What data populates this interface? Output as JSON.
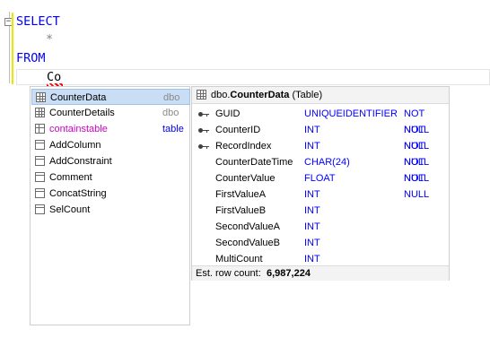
{
  "editor": {
    "line1": "SELECT",
    "line2": "*",
    "line3": "FROM",
    "line4": "Co"
  },
  "completion_list": {
    "items": [
      {
        "label": "CounterData",
        "schema": "dbo",
        "icon": "table-icon",
        "selected": true
      },
      {
        "label": "CounterDetails",
        "schema": "dbo",
        "icon": "table-icon"
      },
      {
        "label": "containstable",
        "schema": "table",
        "icon": "table-valued-function-icon",
        "label_color": "#d000c8",
        "schema_color": "#0000ff"
      },
      {
        "label": "AddColumn",
        "schema": "",
        "icon": "function-icon"
      },
      {
        "label": "AddConstraint",
        "schema": "",
        "icon": "function-icon"
      },
      {
        "label": "Comment",
        "schema": "",
        "icon": "function-icon"
      },
      {
        "label": "ConcatString",
        "schema": "",
        "icon": "function-icon"
      },
      {
        "label": "SelCount",
        "schema": "",
        "icon": "function-icon"
      }
    ]
  },
  "detail": {
    "schema_prefix": "dbo.",
    "object_name": "CounterData",
    "object_kind": "(Table)",
    "columns": [
      {
        "name": "GUID",
        "type": "UNIQUEIDENTIFIER",
        "nullability": "NOT NULL",
        "key": true
      },
      {
        "name": "CounterID",
        "type": "INT",
        "nullability": "NOT NULL",
        "key": true
      },
      {
        "name": "RecordIndex",
        "type": "INT",
        "nullability": "NOT NULL",
        "key": true
      },
      {
        "name": "CounterDateTime",
        "type": "CHAR(24)",
        "nullability": "NOT NULL",
        "key": false
      },
      {
        "name": "CounterValue",
        "type": "FLOAT",
        "nullability": "NOT NULL",
        "key": false
      },
      {
        "name": "FirstValueA",
        "type": "INT",
        "nullability": "",
        "key": false
      },
      {
        "name": "FirstValueB",
        "type": "INT",
        "nullability": "",
        "key": false
      },
      {
        "name": "SecondValueA",
        "type": "INT",
        "nullability": "",
        "key": false
      },
      {
        "name": "SecondValueB",
        "type": "INT",
        "nullability": "",
        "key": false
      },
      {
        "name": "MultiCount",
        "type": "INT",
        "nullability": "",
        "key": false
      }
    ],
    "footer_label": "Est. row count:",
    "row_count": "6,987,224"
  },
  "colors": {
    "keyword": "#0000ff",
    "selection": "#c9def5",
    "function_name": "#d000c8"
  }
}
